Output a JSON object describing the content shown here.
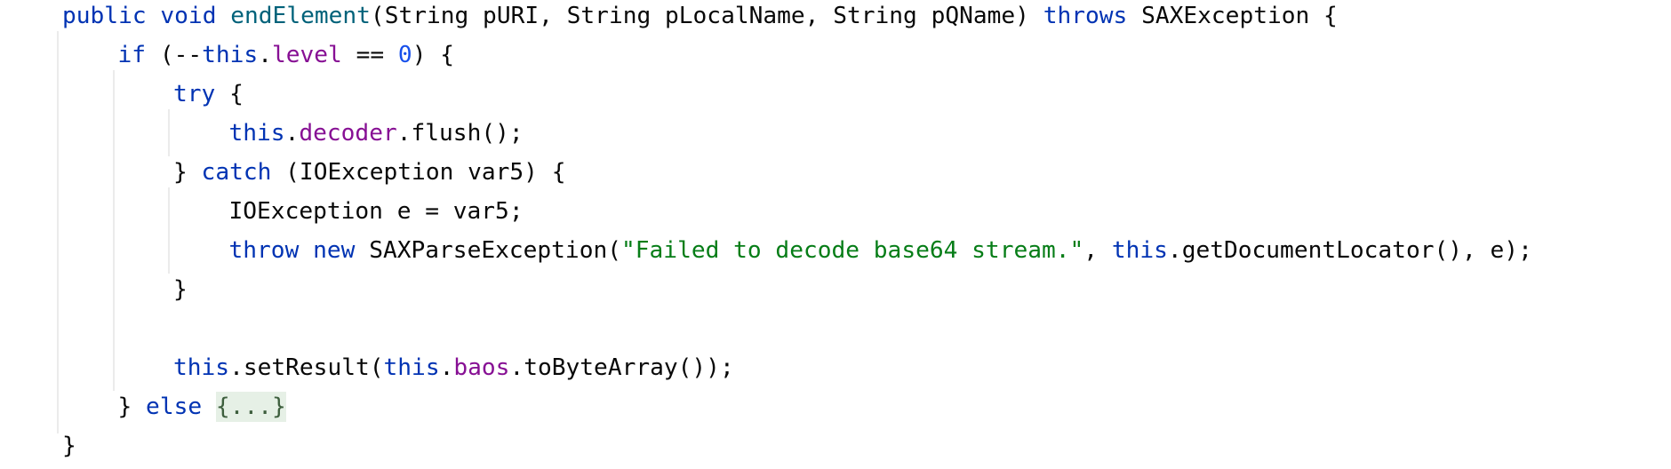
{
  "editor": {
    "language": "Java",
    "colors": {
      "background": "#ffffff",
      "text": "#080808",
      "keyword": "#0033b3",
      "method_declaration": "#00627a",
      "field": "#871094",
      "number": "#1750eb",
      "string": "#067d17",
      "fold_background": "#e6f0e6",
      "indent_guide": "#ebebeb"
    },
    "lines": [
      {
        "indent": 0,
        "tokens": [
          {
            "t": "public",
            "c": "kw"
          },
          {
            "t": " ",
            "c": "plain"
          },
          {
            "t": "void",
            "c": "kw"
          },
          {
            "t": " ",
            "c": "plain"
          },
          {
            "t": "endElement",
            "c": "fn"
          },
          {
            "t": "(String pURI, String pLocalName, String pQName) ",
            "c": "plain"
          },
          {
            "t": "throws",
            "c": "kw"
          },
          {
            "t": " SAXException {",
            "c": "plain"
          }
        ]
      },
      {
        "indent": 1,
        "tokens": [
          {
            "t": "if",
            "c": "kw"
          },
          {
            "t": " (--",
            "c": "plain"
          },
          {
            "t": "this",
            "c": "kw"
          },
          {
            "t": ".",
            "c": "plain"
          },
          {
            "t": "level",
            "c": "fld"
          },
          {
            "t": " == ",
            "c": "plain"
          },
          {
            "t": "0",
            "c": "num"
          },
          {
            "t": ") {",
            "c": "plain"
          }
        ]
      },
      {
        "indent": 2,
        "tokens": [
          {
            "t": "try",
            "c": "kw"
          },
          {
            "t": " {",
            "c": "plain"
          }
        ]
      },
      {
        "indent": 3,
        "tokens": [
          {
            "t": "this",
            "c": "kw"
          },
          {
            "t": ".",
            "c": "plain"
          },
          {
            "t": "decoder",
            "c": "fld"
          },
          {
            "t": ".flush();",
            "c": "plain"
          }
        ]
      },
      {
        "indent": 2,
        "tokens": [
          {
            "t": "} ",
            "c": "plain"
          },
          {
            "t": "catch",
            "c": "kw"
          },
          {
            "t": " (IOException var5) {",
            "c": "plain"
          }
        ]
      },
      {
        "indent": 3,
        "tokens": [
          {
            "t": "IOException e = var5;",
            "c": "plain"
          }
        ]
      },
      {
        "indent": 3,
        "tokens": [
          {
            "t": "throw",
            "c": "kw"
          },
          {
            "t": " ",
            "c": "plain"
          },
          {
            "t": "new",
            "c": "kw"
          },
          {
            "t": " SAXParseException(",
            "c": "plain"
          },
          {
            "t": "\"Failed to decode base64 stream.\"",
            "c": "str"
          },
          {
            "t": ", ",
            "c": "plain"
          },
          {
            "t": "this",
            "c": "kw"
          },
          {
            "t": ".getDocumentLocator(), e);",
            "c": "plain"
          }
        ]
      },
      {
        "indent": 2,
        "tokens": [
          {
            "t": "}",
            "c": "plain"
          }
        ]
      },
      {
        "indent": 0,
        "tokens": []
      },
      {
        "indent": 2,
        "tokens": [
          {
            "t": "this",
            "c": "kw"
          },
          {
            "t": ".setResult(",
            "c": "plain"
          },
          {
            "t": "this",
            "c": "kw"
          },
          {
            "t": ".",
            "c": "plain"
          },
          {
            "t": "baos",
            "c": "fld"
          },
          {
            "t": ".toByteArray());",
            "c": "plain"
          }
        ]
      },
      {
        "indent": 1,
        "tokens": [
          {
            "t": "} ",
            "c": "plain"
          },
          {
            "t": "else",
            "c": "kw"
          },
          {
            "t": " ",
            "c": "plain"
          },
          {
            "t": "{...}",
            "c": "fold"
          }
        ]
      },
      {
        "indent": 0,
        "tokens": [
          {
            "t": "}",
            "c": "plain"
          }
        ]
      }
    ]
  }
}
